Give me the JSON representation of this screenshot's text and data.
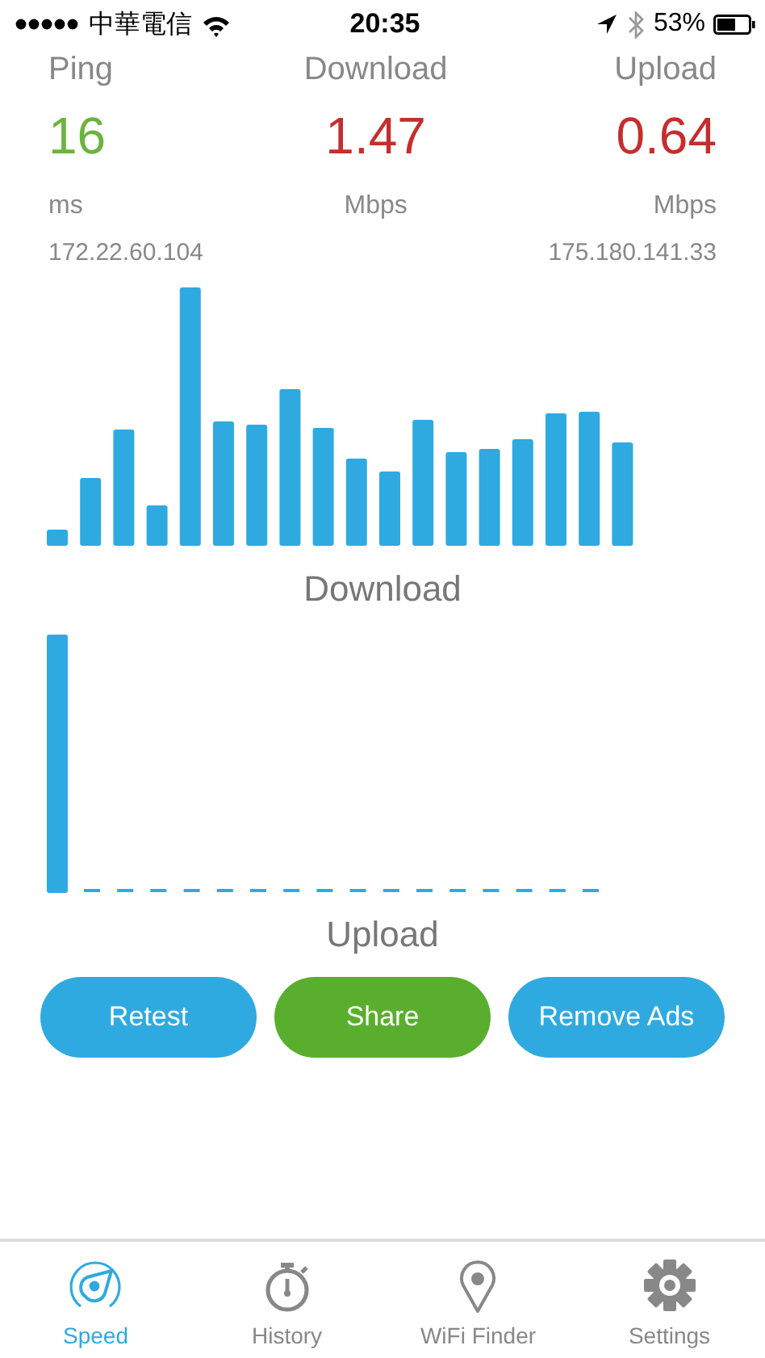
{
  "status_bar": {
    "carrier": "中華電信",
    "time": "20:35",
    "battery": "53%"
  },
  "stats": [
    {
      "label": "Ping",
      "value": "16",
      "unit": "ms",
      "color": "#6db33f",
      "address": "172.22.60.104"
    },
    {
      "label": "Download",
      "value": "1.47",
      "unit": "Mbps",
      "color": "#c62d2d"
    },
    {
      "label": "Upload",
      "value": "0.64",
      "unit": "Mbps",
      "color": "#c62d2d",
      "address": "175.180.141.33"
    }
  ],
  "charts": [
    {
      "kind": "download",
      "title": "Download"
    },
    {
      "kind": "upload",
      "title": "Upload"
    }
  ],
  "buttons": [
    {
      "label": "Retest",
      "color": "#2eaae1"
    },
    {
      "label": "Share",
      "color": "#5aae2e"
    },
    {
      "label": "Remove Ads",
      "color": "#2eaae1"
    }
  ],
  "tabs": [
    {
      "label": "Speed",
      "kind": "speed",
      "selected": true
    },
    {
      "label": "History",
      "kind": "history",
      "selected": false
    },
    {
      "label": "WiFi Finder",
      "kind": "finder",
      "selected": false
    },
    {
      "label": "Settings",
      "kind": "settings",
      "selected": false
    }
  ]
}
